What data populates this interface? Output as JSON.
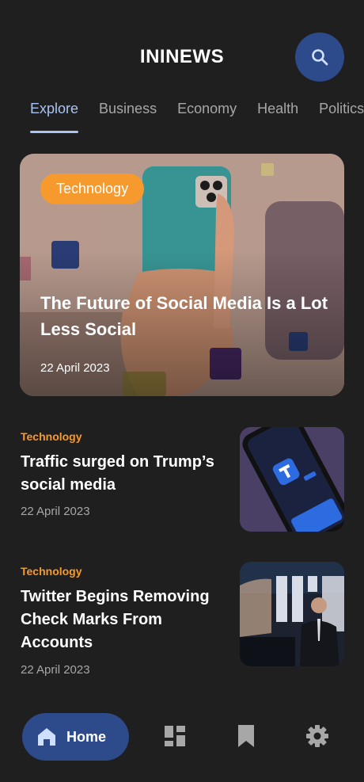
{
  "header": {
    "title": "ININEWS",
    "search_icon": "search-icon"
  },
  "tabs": [
    {
      "label": "Explore",
      "active": true
    },
    {
      "label": "Business",
      "active": false
    },
    {
      "label": "Economy",
      "active": false
    },
    {
      "label": "Health",
      "active": false
    },
    {
      "label": "Politics",
      "active": false
    }
  ],
  "featured": {
    "category": "Technology",
    "title": "The Future of Social Media Is a Lot Less Social",
    "date": "22 April 2023"
  },
  "articles": [
    {
      "category": "Technology",
      "title": "Traffic surged on Trump’s social media",
      "date": "22 April 2023"
    },
    {
      "category": "Technology",
      "title": "Twitter Begins Removing Check Marks From Accounts",
      "date": "22 April 2023"
    }
  ],
  "nav": {
    "home_label": "Home",
    "icons": [
      "home-icon",
      "dashboard-icon",
      "bookmark-icon",
      "settings-icon"
    ]
  },
  "colors": {
    "accent": "#2d4a8a",
    "category": "#f79a2e",
    "tab_active": "#a9c3f2",
    "background": "#1f1f1f"
  }
}
